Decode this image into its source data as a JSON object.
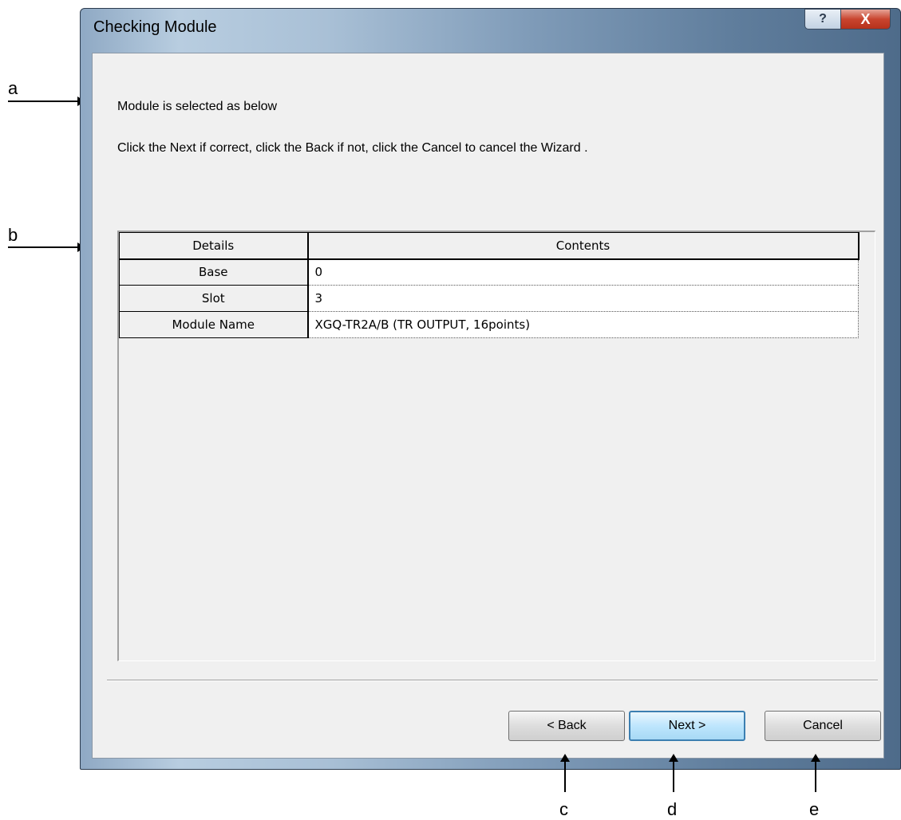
{
  "window": {
    "title": "Checking Module",
    "help_icon": "?",
    "close_icon": "X"
  },
  "messages": {
    "line1": "Module is selected as below",
    "line2": "Click the Next if correct, click the Back if not, click the Cancel to cancel the Wizard ."
  },
  "table": {
    "headers": [
      "Details",
      "Contents"
    ],
    "rows": [
      {
        "details": "Base",
        "contents": "0"
      },
      {
        "details": "Slot",
        "contents": "3"
      },
      {
        "details": "Module Name",
        "contents": "XGQ-TR2A/B (TR OUTPUT, 16points)"
      }
    ]
  },
  "buttons": {
    "back": "< Back",
    "next": "Next >",
    "cancel": "Cancel"
  },
  "annotations": {
    "a": "a",
    "b": "b",
    "c": "c",
    "d": "d",
    "e": "e"
  }
}
